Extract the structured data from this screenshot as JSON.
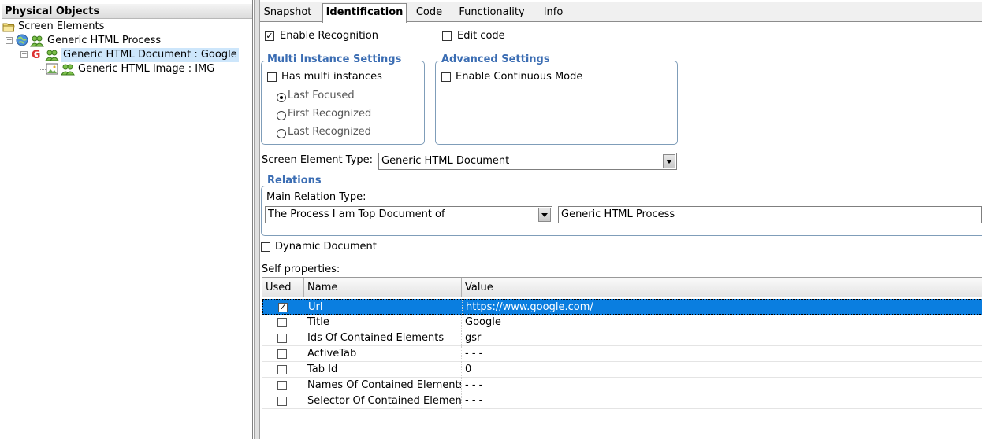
{
  "left_pane": {
    "header": "Physical Objects",
    "tree": {
      "root": "Screen Elements",
      "process": "Generic HTML Process",
      "document": "Generic HTML Document : Google",
      "image": "Generic HTML Image : IMG"
    }
  },
  "tabs": [
    {
      "label": "Snapshot"
    },
    {
      "label": "Identification"
    },
    {
      "label": "Code"
    },
    {
      "label": "Functionality"
    },
    {
      "label": "Info"
    }
  ],
  "identification": {
    "enable_recognition": {
      "label": "Enable Recognition",
      "checked": true
    },
    "edit_code": {
      "label": "Edit code",
      "checked": false
    },
    "multi_instance": {
      "title": "Multi Instance Settings",
      "has_multi": {
        "label": "Has multi instances",
        "checked": false
      },
      "radios": [
        {
          "label": "Last Focused",
          "selected": true
        },
        {
          "label": "First Recognized",
          "selected": false
        },
        {
          "label": "Last Recognized",
          "selected": false
        }
      ]
    },
    "advanced": {
      "title": "Advanced Settings",
      "continuous": {
        "label": "Enable Continuous Mode",
        "checked": false
      }
    },
    "screen_element_type": {
      "label": "Screen Element Type:",
      "value": "Generic HTML Document"
    },
    "relations": {
      "title": "Relations",
      "main_relation_label": "Main Relation Type:",
      "relation_type": "The Process I am Top Document of",
      "related_element": "Generic HTML Process"
    },
    "dynamic_document": {
      "label": "Dynamic Document",
      "checked": false
    },
    "self_properties_label": "Self properties:",
    "table": {
      "headers": {
        "used": "Used",
        "name": "Name",
        "value": "Value"
      },
      "rows": [
        {
          "used": true,
          "name": "Url",
          "value": "https://www.google.com/"
        },
        {
          "used": false,
          "name": "Title",
          "value": "Google"
        },
        {
          "used": false,
          "name": "Ids Of Contained Elements",
          "value": "gsr"
        },
        {
          "used": false,
          "name": "ActiveTab",
          "value": "- - -"
        },
        {
          "used": false,
          "name": "Tab Id",
          "value": "0"
        },
        {
          "used": false,
          "name": "Names Of Contained Elements",
          "value": "- - -"
        },
        {
          "used": false,
          "name": "Selector Of Contained Element",
          "value": "- - -"
        }
      ]
    }
  }
}
